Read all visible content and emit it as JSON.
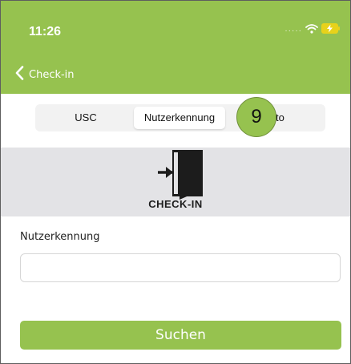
{
  "status_bar": {
    "time": "11:26"
  },
  "nav": {
    "back_label": "Check-in"
  },
  "segments": [
    {
      "label": "USC",
      "active": false
    },
    {
      "label": "Nutzerkennung",
      "active": true
    },
    {
      "label": "to",
      "active": false
    }
  ],
  "step_badge": "9",
  "banner": {
    "text": "CHECK-IN"
  },
  "form": {
    "label": "Nutzerkennung",
    "value": "",
    "placeholder": ""
  },
  "search_button": "Suchen",
  "colors": {
    "accent": "#96c24f",
    "banner_bg": "#e3e3e6",
    "segment_bg": "#f2f2f2"
  },
  "icons": [
    "wifi-icon",
    "battery-charging-icon",
    "chevron-left-icon",
    "door-enter-icon"
  ]
}
